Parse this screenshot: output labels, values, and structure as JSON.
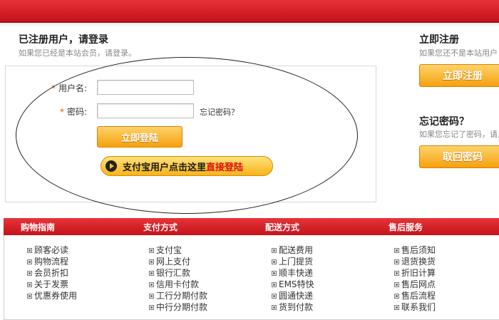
{
  "login": {
    "title": "已注册用户，请登录",
    "subtitle": "如果您已经是本站会员，请登录。",
    "username_label": "用户名:",
    "password_label": "密码:",
    "username_value": "",
    "password_value": "",
    "forgot_link": "忘记密码？",
    "login_button": "立即登陆",
    "alipay_prefix": "支付宝用户点击这里",
    "alipay_highlight": "直接登陆"
  },
  "register": {
    "title": "立即注册",
    "subtitle": "如果您还不是本站用户",
    "button": "立即注册"
  },
  "forgot": {
    "title": "忘记密码？",
    "subtitle": "如果您忘记了密码，请点",
    "button": "取回密码"
  },
  "footer": {
    "columns": [
      {
        "title": "购物指南",
        "items": [
          "顾客必读",
          "购物流程",
          "会员折扣",
          "关于发票",
          "优惠券使用"
        ]
      },
      {
        "title": "支付方式",
        "items": [
          "支付宝",
          "网上支付",
          "银行汇款",
          "信用卡付款",
          "工行分期付款",
          "中行分期付款"
        ]
      },
      {
        "title": "配送方式",
        "items": [
          "配送费用",
          "上门提货",
          "顺丰快递",
          "EMS特快",
          "圆通快递",
          "货到付款"
        ]
      },
      {
        "title": "售后服务",
        "items": [
          "售后须知",
          "退货换货",
          "折旧计算",
          "售后网点",
          "售后流程",
          "联系我们"
        ]
      }
    ]
  },
  "colors": {
    "brand_red": "#d0181f",
    "button_orange": "#f5a10f"
  }
}
